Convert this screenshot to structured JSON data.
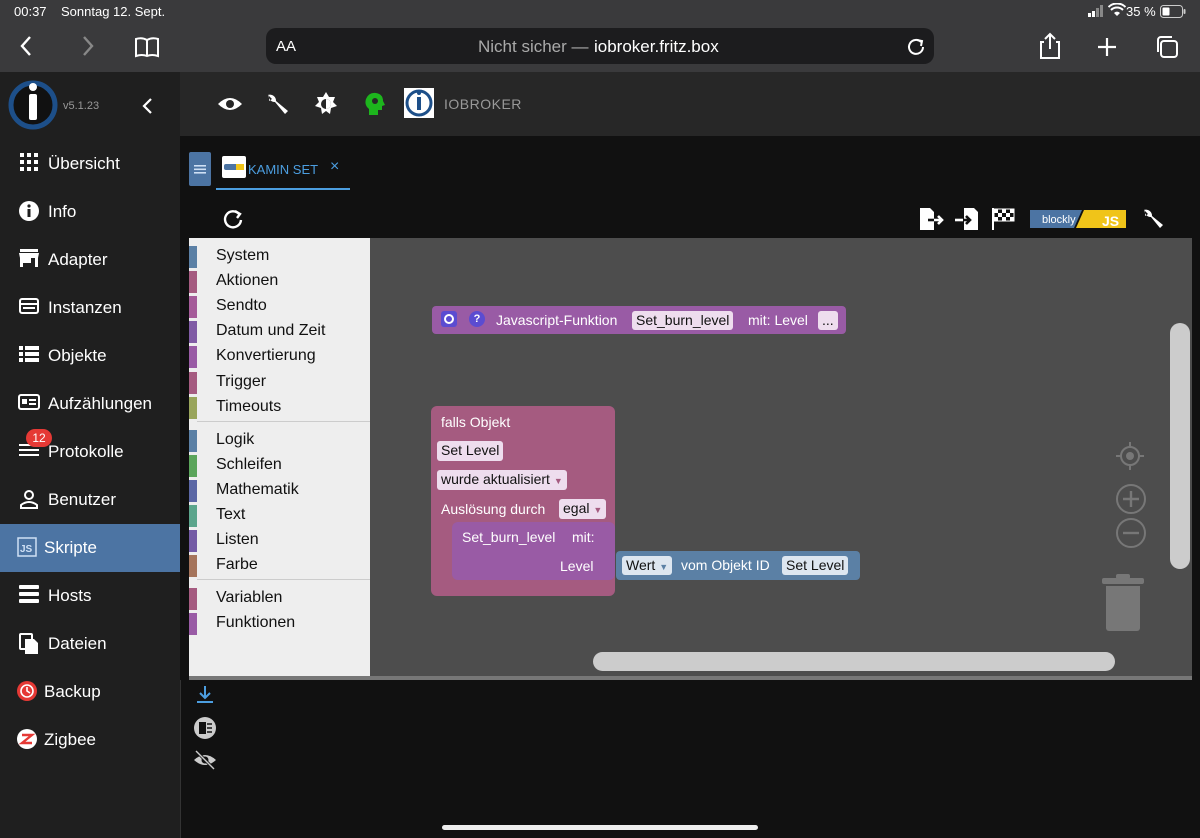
{
  "status_bar": {
    "time": "00:37",
    "date": "Sonntag 12. Sept.",
    "battery": "35 %"
  },
  "safari": {
    "text_size": "AA",
    "url_prefix": "Nicht sicher —",
    "url_host": "iobroker.fritz.box"
  },
  "sidebar": {
    "version": "v5.1.23",
    "items": [
      {
        "label": "Übersicht",
        "icon": "apps-icon"
      },
      {
        "label": "Info",
        "icon": "info-icon"
      },
      {
        "label": "Adapter",
        "icon": "store-icon"
      },
      {
        "label": "Instanzen",
        "icon": "instances-icon"
      },
      {
        "label": "Objekte",
        "icon": "list-icon"
      },
      {
        "label": "Aufzählungen",
        "icon": "enum-icon"
      },
      {
        "label": "Protokolle",
        "icon": "log-icon",
        "badge": "12"
      },
      {
        "label": "Benutzer",
        "icon": "user-icon"
      },
      {
        "label": "Skripte",
        "icon": "js-icon",
        "active": true
      },
      {
        "label": "Hosts",
        "icon": "hosts-icon"
      },
      {
        "label": "Dateien",
        "icon": "files-icon"
      },
      {
        "label": "Backup",
        "icon": "backup-icon"
      },
      {
        "label": "Zigbee",
        "icon": "zigbee-icon"
      }
    ]
  },
  "appbar": {
    "brand": "IOBROKER"
  },
  "tab": {
    "label": "KAMIN SET",
    "close": "×"
  },
  "toolbox": {
    "groups": [
      [
        {
          "label": "System",
          "color": "#5b80a5"
        },
        {
          "label": "Aktionen",
          "color": "#a55b80"
        },
        {
          "label": "Sendto",
          "color": "#a55b99"
        },
        {
          "label": "Datum und Zeit",
          "color": "#805ba5"
        },
        {
          "label": "Konvertierung",
          "color": "#995ba5"
        },
        {
          "label": "Trigger",
          "color": "#a55b80"
        },
        {
          "label": "Timeouts",
          "color": "#99a55b"
        }
      ],
      [
        {
          "label": "Logik",
          "color": "#5b80a5"
        },
        {
          "label": "Schleifen",
          "color": "#5ba55b"
        },
        {
          "label": "Mathematik",
          "color": "#5b67a5"
        },
        {
          "label": "Text",
          "color": "#5ba58c"
        },
        {
          "label": "Listen",
          "color": "#745ba5"
        },
        {
          "label": "Farbe",
          "color": "#a5745b"
        }
      ],
      [
        {
          "label": "Variablen",
          "color": "#a55b80"
        },
        {
          "label": "Funktionen",
          "color": "#995ba5"
        }
      ]
    ]
  },
  "blocks": {
    "function_def": {
      "label": "Javascript-Funktion",
      "name": "Set_burn_level",
      "params": "mit: Level",
      "more": "..."
    },
    "trigger": {
      "title": "falls Objekt",
      "object": "Set Level",
      "condition": "wurde aktualisiert",
      "trigger_label": "Auslösung durch",
      "trigger_value": "egal"
    },
    "call": {
      "name": "Set_burn_level",
      "with": "mit:",
      "param": "Level"
    },
    "value": {
      "dropdown": "Wert",
      "text": "vom Objekt ID",
      "object": "Set Level"
    }
  },
  "colors": {
    "accent": "#4c74a3",
    "function_block": "#995ba5",
    "trigger_block": "#a55b80",
    "value_block": "#5b80a5"
  }
}
